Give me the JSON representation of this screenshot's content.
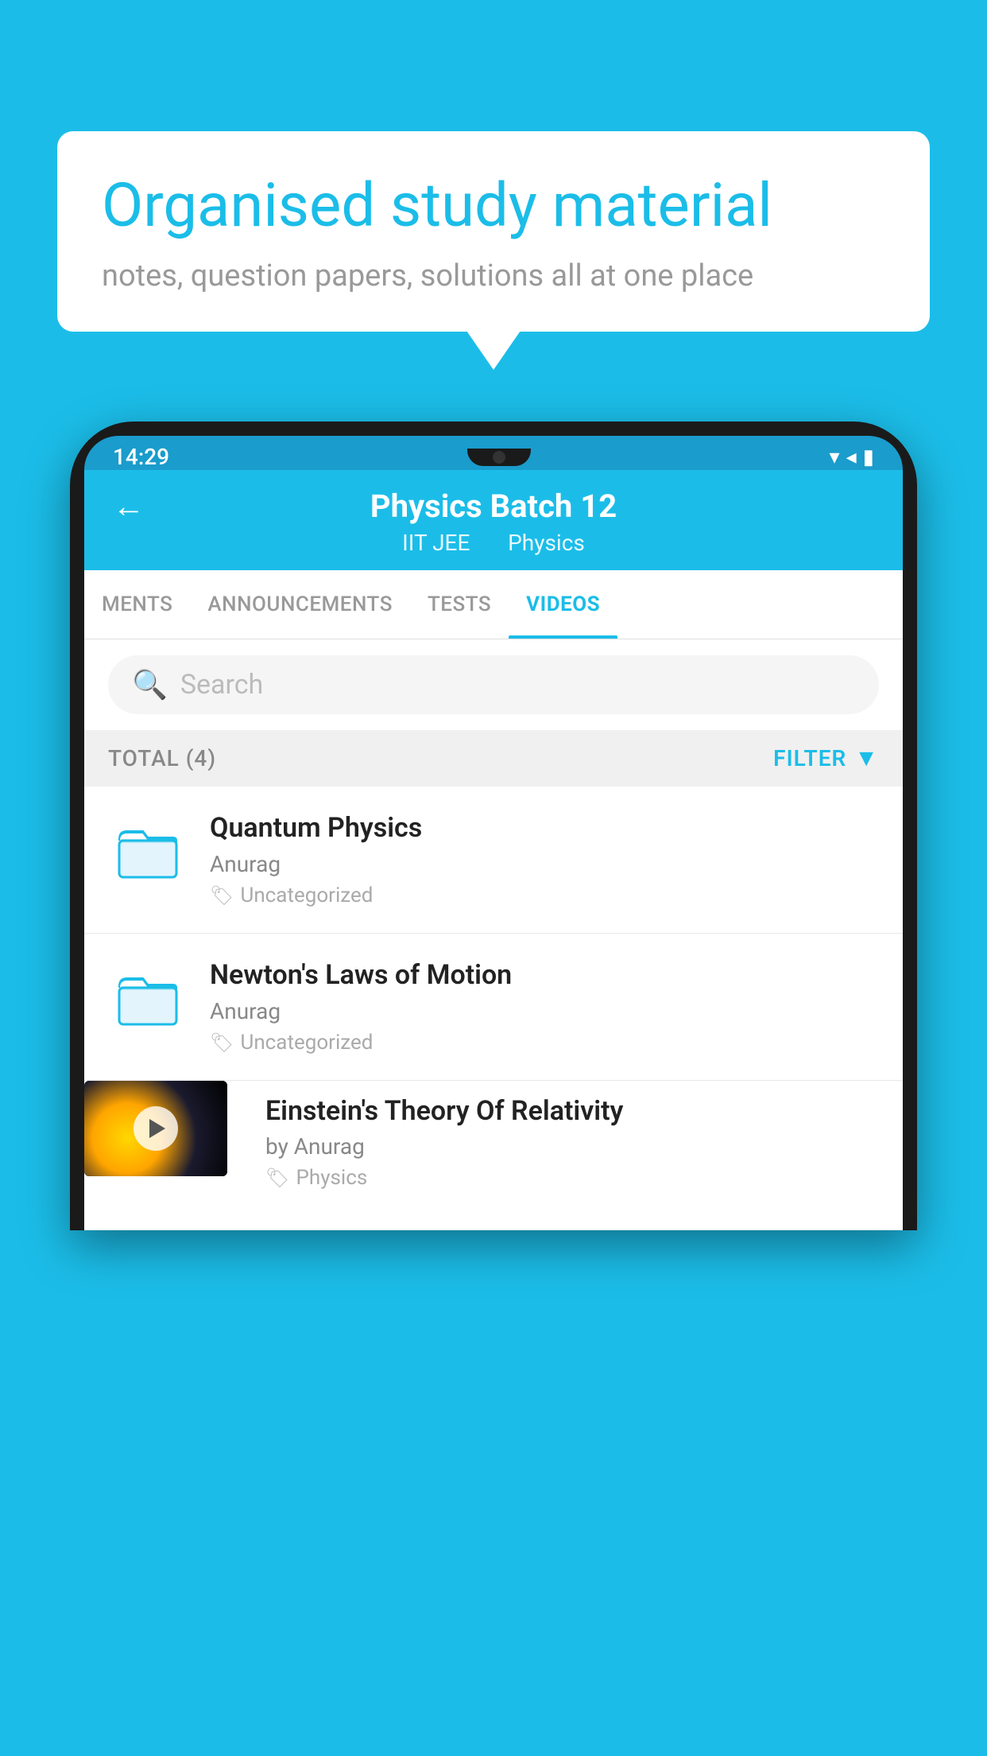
{
  "page": {
    "background_color": "#1BBDE8"
  },
  "speech_bubble": {
    "heading": "Organised study material",
    "subtext": "notes, question papers, solutions all at one place"
  },
  "status_bar": {
    "time": "14:29",
    "icons": [
      "▾",
      "◂",
      "▮"
    ]
  },
  "app_header": {
    "back_label": "←",
    "title": "Physics Batch 12",
    "subtitle_part1": "IIT JEE",
    "subtitle_part2": "Physics"
  },
  "tabs": [
    {
      "label": "MENTS",
      "active": false
    },
    {
      "label": "ANNOUNCEMENTS",
      "active": false
    },
    {
      "label": "TESTS",
      "active": false
    },
    {
      "label": "VIDEOS",
      "active": true
    }
  ],
  "search": {
    "placeholder": "Search"
  },
  "filter_bar": {
    "total_label": "TOTAL (4)",
    "filter_label": "FILTER"
  },
  "video_items": [
    {
      "id": 1,
      "title": "Quantum Physics",
      "author": "Anurag",
      "tag": "Uncategorized",
      "has_thumbnail": false
    },
    {
      "id": 2,
      "title": "Newton's Laws of Motion",
      "author": "Anurag",
      "tag": "Uncategorized",
      "has_thumbnail": false
    },
    {
      "id": 3,
      "title": "Einstein's Theory Of Relativity",
      "author": "by Anurag",
      "tag": "Physics",
      "has_thumbnail": true
    }
  ]
}
